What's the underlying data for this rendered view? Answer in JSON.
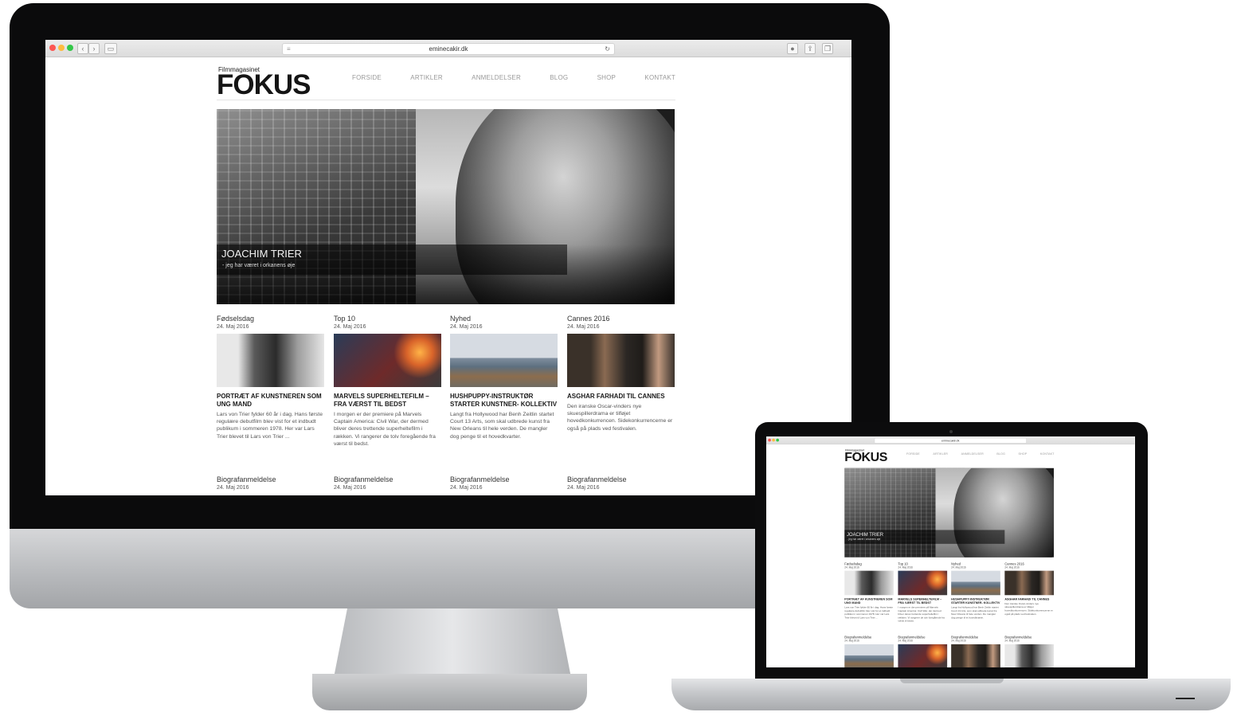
{
  "browser": {
    "url": "eminecakir.dk",
    "reload_icon": "reload-icon",
    "back_label": "‹",
    "forward_label": "›"
  },
  "site": {
    "logo_small": "Filmmagasinet",
    "logo_big": "FOKUS",
    "nav": [
      "FORSIDE",
      "ARTIKLER",
      "ANMELDELSER",
      "BLOG",
      "SHOP",
      "KONTAKT"
    ]
  },
  "hero": {
    "title": "JOACHIM TRIER",
    "subtitle": "- jeg har været i orkanens øje"
  },
  "articles": [
    {
      "category": "Fødselsdag",
      "date": "24. Maj 2016",
      "title": "PORTRÆT AF KUNSTNEREN SOM UNG MAND",
      "text": "Lars von Trier fylder 60 år i dag. Hans første regulære debutfilm blev vist for et indbudt publikum i sommeren 1978. Her var Lars Trier blevet til Lars von Trier ..."
    },
    {
      "category": "Top 10",
      "date": "24. Maj 2016",
      "title": "MARVELS SUPERHELTEFILM – FRA VÆRST TIL BEDST",
      "text": "I morgen er der premiere på Marvels Captain America: Civil War, der dermed bliver deres trettende superheltefilm i rækken. Vi rangerer de tolv foregående fra værst til bedst."
    },
    {
      "category": "Nyhed",
      "date": "24. Maj 2016",
      "title": "HUSHPUPPY-INSTRUKTØR STARTER KUNSTNER- KOLLEKTIV",
      "text": "Langt fra Hollywood har Benh Zeitlin startet Court 13 Arts, som skal udbrede kunst fra New Orleans til hele verden. De mangler dog penge til et hovedkvarter."
    },
    {
      "category": "Cannes 2016",
      "date": "24. Maj 2016",
      "title": "ASGHAR FARHADI TIL CANNES",
      "text": "Den iranske Oscar-vinders nye skuespillerdrama er tilføjet hovedkonkurrencen. Sidekonkurrencerne er også på plads ved festivalen."
    }
  ],
  "reviews": [
    {
      "category": "Biografanmeldelse",
      "date": "24. Maj 2016"
    },
    {
      "category": "Biografanmeldelse",
      "date": "24. Maj 2016"
    },
    {
      "category": "Biografanmeldelse",
      "date": "24. Maj 2016"
    },
    {
      "category": "Biografanmeldelse",
      "date": "24. Maj 2016"
    }
  ]
}
